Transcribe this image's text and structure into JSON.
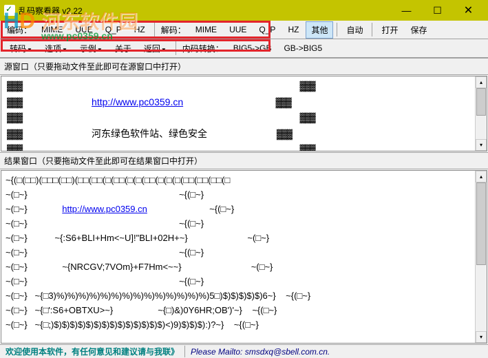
{
  "window": {
    "title": "乱码察看器 v2.22"
  },
  "toolbar1": {
    "encode_label": "编码：",
    "mime": "MIME",
    "uue": "UUE",
    "qp": "Q_P",
    "hz": "HZ",
    "decode_label": "解码：",
    "d_mime": "MIME",
    "d_uue": "UUE",
    "d_qp": "Q_P",
    "d_hz": "HZ",
    "other": "其他",
    "auto": "自动",
    "open": "打开",
    "save": "保存"
  },
  "toolbar2": {
    "convert": "转码",
    "options": "选项",
    "examples": "示例",
    "about": "关于",
    "back": "返回",
    "nei_convert_label": "内码转换：",
    "big5gb": "BIG5->GB",
    "gbbig5": "GB->BIG5"
  },
  "panels": {
    "source_label": "源窗口（只要拖动文件至此即可在源窗口中打开）",
    "result_label": "结果窗口（只要拖动文件至此即可在结果窗口中打开）"
  },
  "source": {
    "url_text": "http://www.pc0359.cn",
    "line2": "河东绿色软件站、绿色安全",
    "block": "▓▓▓"
  },
  "result": {
    "line1": "~{(□(□□)(□□□(□□)(□□(□□(□(□□(□(□(□□(□(□(□(□□(□□(□□(□",
    "line2": "~(□~}                                                             ~{(□~}",
    "url_line_prefix": "~(□~}              ",
    "url_text": "http://www.pc0359.cn",
    "url_line_suffix": "                         ~{(□~}",
    "line4": "~(□~}                                                             ~{(□~}",
    "line5": "~(□~}           ~{:S6+BLI+Hm<~U]!\"BLI+02H+~}                        ~(□~}",
    "line6": "~(□~}                                                             ~{(□~}",
    "line7": "~(□~}              ~{NRCGV;7VOm}+F7Hm<~~}                            ~(□~}",
    "line8": "~(□~}                                                             ~{(□~}",
    "line9": "~(□~}   ~{□3)%)%)%)%)%)%)%)%)%)%)%)%)%)%)5□)$)$)$)$)$)6~}    ~{(□~}",
    "line10": "~(□~}   ~{□':S6+OBTXU>~}                  ~{□)&)0Y6HR;OB')'~}    ~{(□~}",
    "line11": "~(□~}   ~{□;)$)$)$)$)$)$)$)$)$)$)$)$)$)$)<)9)$)$)$):)?~}    ~{(□~}"
  },
  "statusbar": {
    "left": "欢迎使用本软件，有任何意见和建议请与我联》",
    "right": "Please Mailto: smsdxq@sbell.com.cn."
  },
  "watermark": {
    "text": "河东软件园",
    "url": "www.pc0359.cn"
  }
}
